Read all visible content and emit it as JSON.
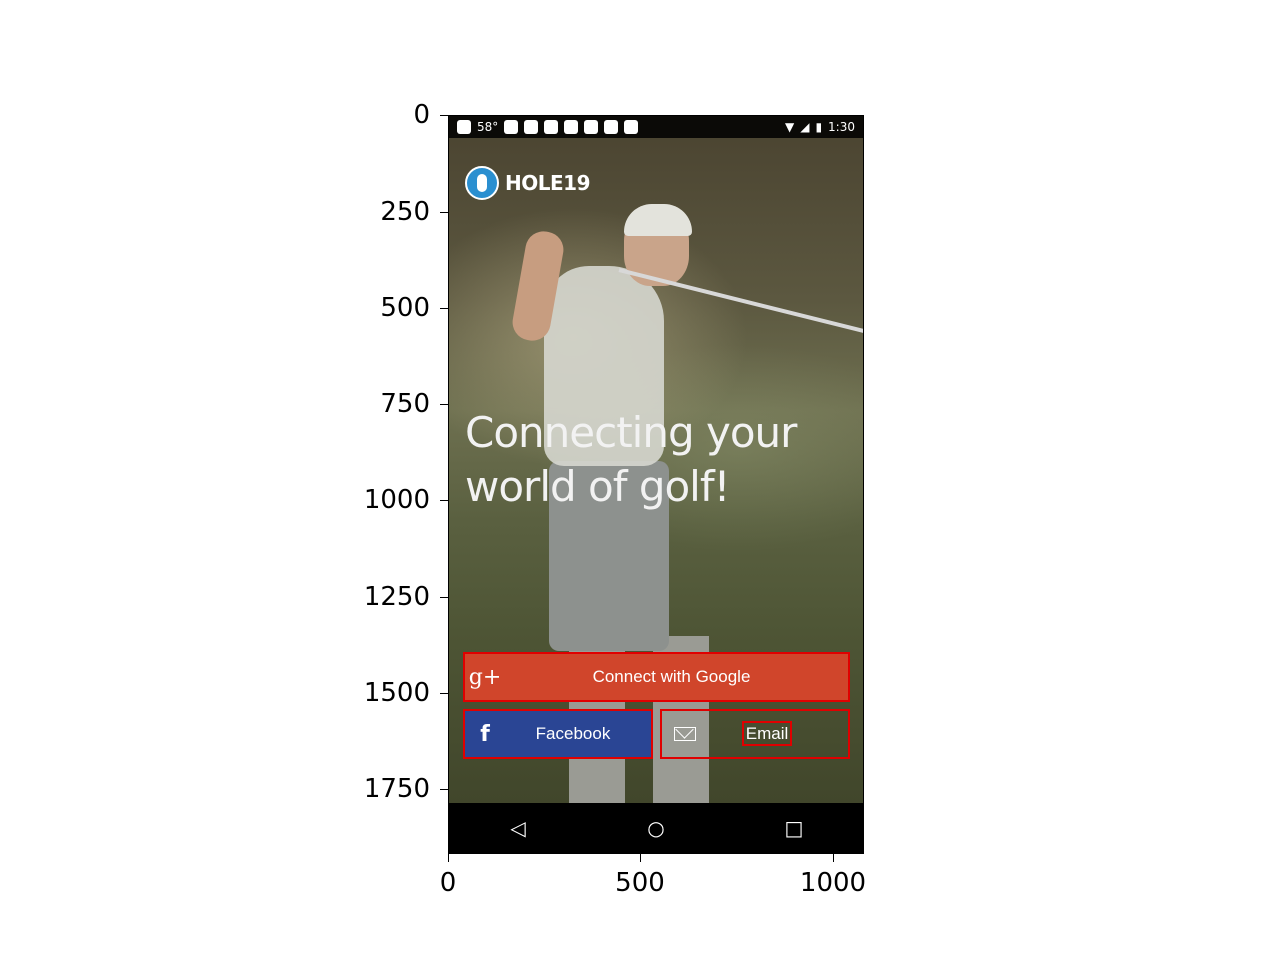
{
  "axes": {
    "y_ticks": [
      "0",
      "250",
      "500",
      "750",
      "1000",
      "1250",
      "1500",
      "1750"
    ],
    "x_ticks": [
      "0",
      "500",
      "1000"
    ]
  },
  "status_bar": {
    "temperature": "58°",
    "time": "1:30"
  },
  "app": {
    "logo_text": "HOLE19",
    "headline_line1": "Connecting your",
    "headline_line2": "world of golf!"
  },
  "buttons": {
    "google_icon": "g+",
    "google_label": "Connect with Google",
    "facebook_icon": "f",
    "facebook_label": "Facebook",
    "email_label": "Email"
  },
  "nav": {
    "back_glyph": "◁",
    "home_glyph": "○",
    "recents_glyph": "□"
  },
  "colors": {
    "google": "#d0452b",
    "facebook": "#2a4594",
    "highlight": "#e00000",
    "logo": "#2a8fd0"
  }
}
